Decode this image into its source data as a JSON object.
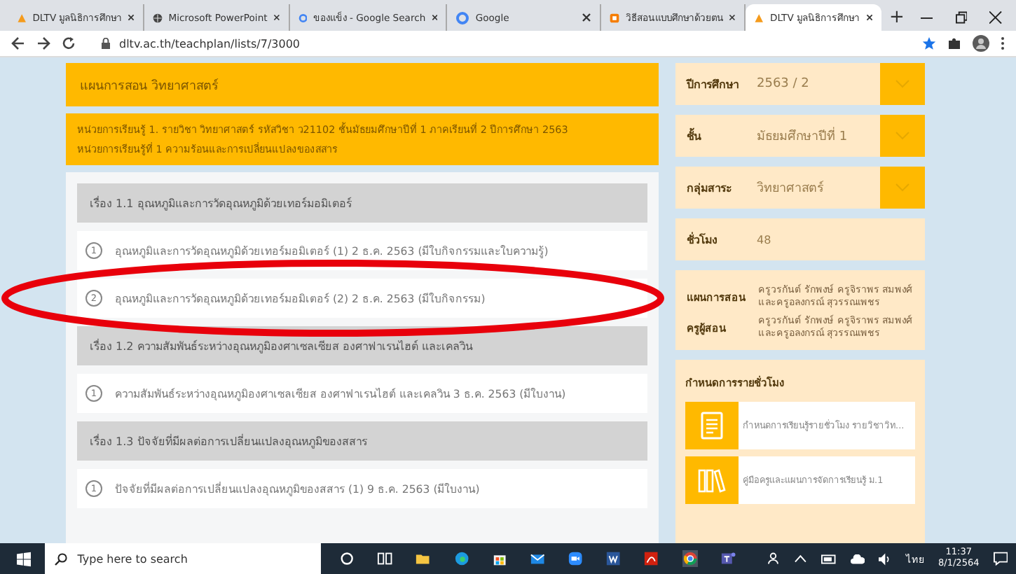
{
  "browser": {
    "tabs": [
      {
        "title": "DLTV มูลนิธิการศึกษา",
        "selected": false
      },
      {
        "title": "Microsoft PowerPoint",
        "selected": false
      },
      {
        "title": "ของแข็ง - Google Search",
        "selected": false
      },
      {
        "title": "Google",
        "selected": false
      },
      {
        "title": "วิธีสอนแบบศึกษาด้วยตน",
        "selected": false
      },
      {
        "title": "DLTV มูลนิธิการศึกษา",
        "selected": true
      }
    ],
    "new_tab": "+",
    "url": "dltv.ac.th/teachplan/lists/7/3000"
  },
  "plan": {
    "title": "แผนการสอน วิทยาศาสตร์",
    "unit_lines": [
      "หน่วยการเรียนรู้ 1. รายวิชา วิทยาศาสตร์ รหัสวิชา ว21102 ชั้นมัธยมศึกษาปีที่ 1 ภาคเรียนที่ 2 ปีการศึกษา 2563",
      "หน่วยการเรียนรู้ที่ 1 ความร้อนและการเปลี่ยนแปลงของสสาร"
    ],
    "topics": [
      {
        "title": "เรื่อง 1.1 อุณหภูมิและการวัดอุณหภูมิด้วยเทอร์มอมิเตอร์",
        "lessons": [
          {
            "number": "1",
            "title": "อุณหภูมิและการวัดอุณหภูมิด้วยเทอร์มอมิเตอร์ (1) 2 ธ.ค. 2563 (มีใบกิจกรรมและใบความรู้)",
            "circled": false
          },
          {
            "number": "2",
            "title": "อุณหภูมิและการวัดอุณหภูมิด้วยเทอร์มอมิเตอร์ (2) 2 ธ.ค. 2563 (มีใบกิจกรรม)",
            "circled": true
          }
        ]
      },
      {
        "title": "เรื่อง 1.2 ความสัมพันธ์ระหว่างอุณหภูมิองศาเซลเซียส องศาฟาเรนไฮต์ และเคลวิน",
        "lessons": [
          {
            "number": "1",
            "title": "ความสัมพันธ์ระหว่างอุณหภูมิองศาเซลเซียส องศาฟาเรนไฮต์ และเคลวิน 3 ธ.ค. 2563 (มีใบงาน)",
            "circled": false
          }
        ]
      },
      {
        "title": "เรื่อง 1.3 ปัจจัยที่มีผลต่อการเปลี่ยนแปลงอุณหภูมิของสสาร",
        "lessons": [
          {
            "number": "1",
            "title": "ปัจจัยที่มีผลต่อการเปลี่ยนแปลงอุณหภูมิของสสาร (1) 9 ธ.ค. 2563 (มีใบงาน)",
            "circled": false
          }
        ]
      }
    ]
  },
  "filters": [
    {
      "label": "ปีการศึกษา",
      "value": "2563 / 2",
      "kind": "dropdown"
    },
    {
      "label": "ชั้น",
      "value": "มัธยมศึกษาปีที่ 1",
      "kind": "dropdown"
    },
    {
      "label": "กลุ่มสาระ",
      "value": "วิทยาศาสตร์",
      "kind": "dropdown"
    },
    {
      "label": "ชั่วโมง",
      "value": "48",
      "kind": "static"
    }
  ],
  "teachers": [
    {
      "label": "แผนการสอน",
      "value": "ครูวรกันต์ รักพงษ์ ครูจิราพร สมพงศ์ และครูอลงกรณ์ สุวรรณเพชร"
    },
    {
      "label": "ครูผู้สอน",
      "value": "ครูวรกันต์ รักพงษ์ ครูจิราพร สมพงศ์ และครูอลงกรณ์ สุวรรณเพชร"
    }
  ],
  "schedule": {
    "title": "กำหนดการรายชั่วโมง",
    "links": [
      {
        "title": "กำหนดการเรียนรู้รายชั่วโมง รายวิชาวิท..."
      },
      {
        "title": "คู่มือครูและแผนการจัดการเรียนรู้ ม.1"
      }
    ]
  },
  "taskbar": {
    "search_placeholder": "Type here to search",
    "language": "ไทย",
    "time": "11:37",
    "date": "8/1/2564"
  }
}
